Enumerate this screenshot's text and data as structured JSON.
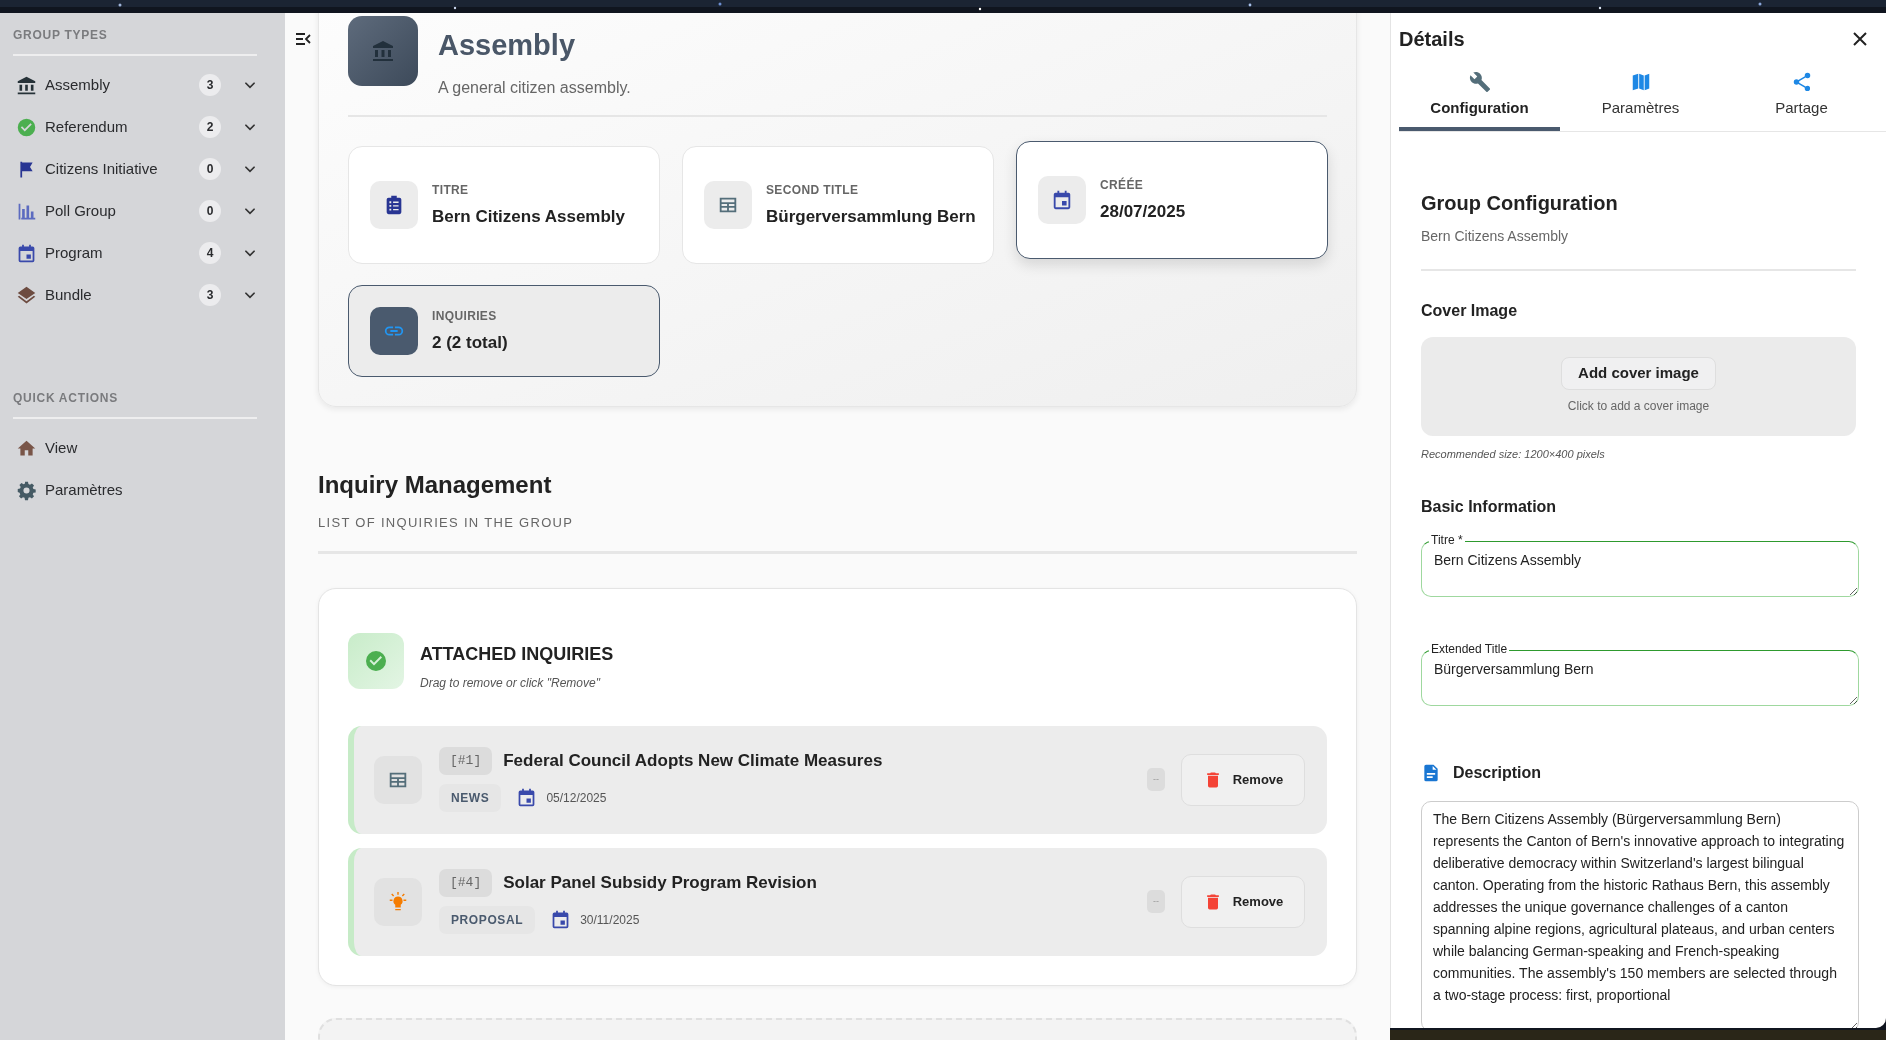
{
  "sidebar": {
    "sections": [
      {
        "title": "GROUP TYPES",
        "items": [
          {
            "kind": "assembly",
            "label": "Assembly",
            "count": "3",
            "expanded": false
          },
          {
            "kind": "check",
            "label": "Referendum",
            "count": "2",
            "expanded": false
          },
          {
            "kind": "flag",
            "label": "Citizens Initiative",
            "count": "0",
            "expanded": false
          },
          {
            "kind": "poll",
            "label": "Poll Group",
            "count": "0",
            "expanded": false
          },
          {
            "kind": "calendar",
            "label": "Program",
            "count": "4",
            "expanded": false
          },
          {
            "kind": "layers",
            "label": "Bundle",
            "count": "3",
            "expanded": false
          }
        ]
      },
      {
        "title": "QUICK ACTIONS",
        "items": [
          {
            "kind": "home",
            "label": "View"
          },
          {
            "kind": "gear",
            "label": "Paramètres"
          }
        ]
      }
    ]
  },
  "group": {
    "title": "Assembly",
    "subtitle": "A general citizen assembly.",
    "info_cards": [
      {
        "kind": "clipboard",
        "label": "TITRE",
        "value": "Bern Citizens Assembly",
        "selected": false,
        "highlighted": false
      },
      {
        "kind": "news",
        "label": "SECOND TITLE",
        "value": "Bürgerversammlung Bern",
        "selected": false,
        "highlighted": false
      },
      {
        "kind": "calendar",
        "label": "CRÉÉE",
        "value": "28/07/2025",
        "selected": true,
        "highlighted": false
      },
      {
        "kind": "link",
        "label": "INQUIRIES",
        "value": "2 (2 total)",
        "selected": false,
        "highlighted": true
      }
    ]
  },
  "inquiries": {
    "title": "Inquiry Management",
    "subtitle": "LIST OF INQUIRIES IN THE GROUP",
    "attached": {
      "title": "ATTACHED INQUIRIES",
      "hint": "Drag to remove or click \"Remove\"",
      "items": [
        {
          "kind": "news",
          "ref": "[#1]",
          "title": "Federal Council Adopts New Climate Measures",
          "type": "NEWS",
          "date": "05/12/2025",
          "status": "--",
          "action": "Remove"
        },
        {
          "kind": "bulb",
          "ref": "[#4]",
          "title": "Solar Panel Subsidy Program Revision",
          "type": "PROPOSAL",
          "date": "30/11/2025",
          "status": "--",
          "action": "Remove"
        }
      ]
    }
  },
  "details": {
    "title": "Détails",
    "tabs": [
      {
        "kind": "wrench",
        "label": "Configuration",
        "selected": true
      },
      {
        "kind": "map",
        "label": "Paramètres",
        "selected": false
      },
      {
        "kind": "share",
        "label": "Partage",
        "selected": false
      }
    ],
    "config": {
      "title": "Group Configuration",
      "subtitle": "Bern Citizens Assembly",
      "cover": {
        "title": "Cover Image",
        "button": "Add cover image",
        "hint": "Click to add a cover image",
        "note": "Recommended size: 1200×400 pixels"
      },
      "basic": {
        "title": "Basic Information",
        "fields": [
          {
            "label": "Titre *",
            "value": "Bern Citizens Assembly"
          },
          {
            "label": "Extended Title",
            "value": "Bürgerversammlung Bern"
          }
        ]
      },
      "description": {
        "title": "Description",
        "value": "The Bern Citizens Assembly (Bürgerversammlung Bern) represents the Canton of Bern's innovative approach to integrating deliberative democracy within Switzerland's largest bilingual canton. Operating from the historic Rathaus Bern, this assembly addresses the unique governance challenges of a canton spanning alpine regions, agricultural plateaus, and urban centers while balancing German-speaking and French-speaking communities. The assembly's 150 members are selected through a two-stage process: first, proportional"
      }
    }
  }
}
